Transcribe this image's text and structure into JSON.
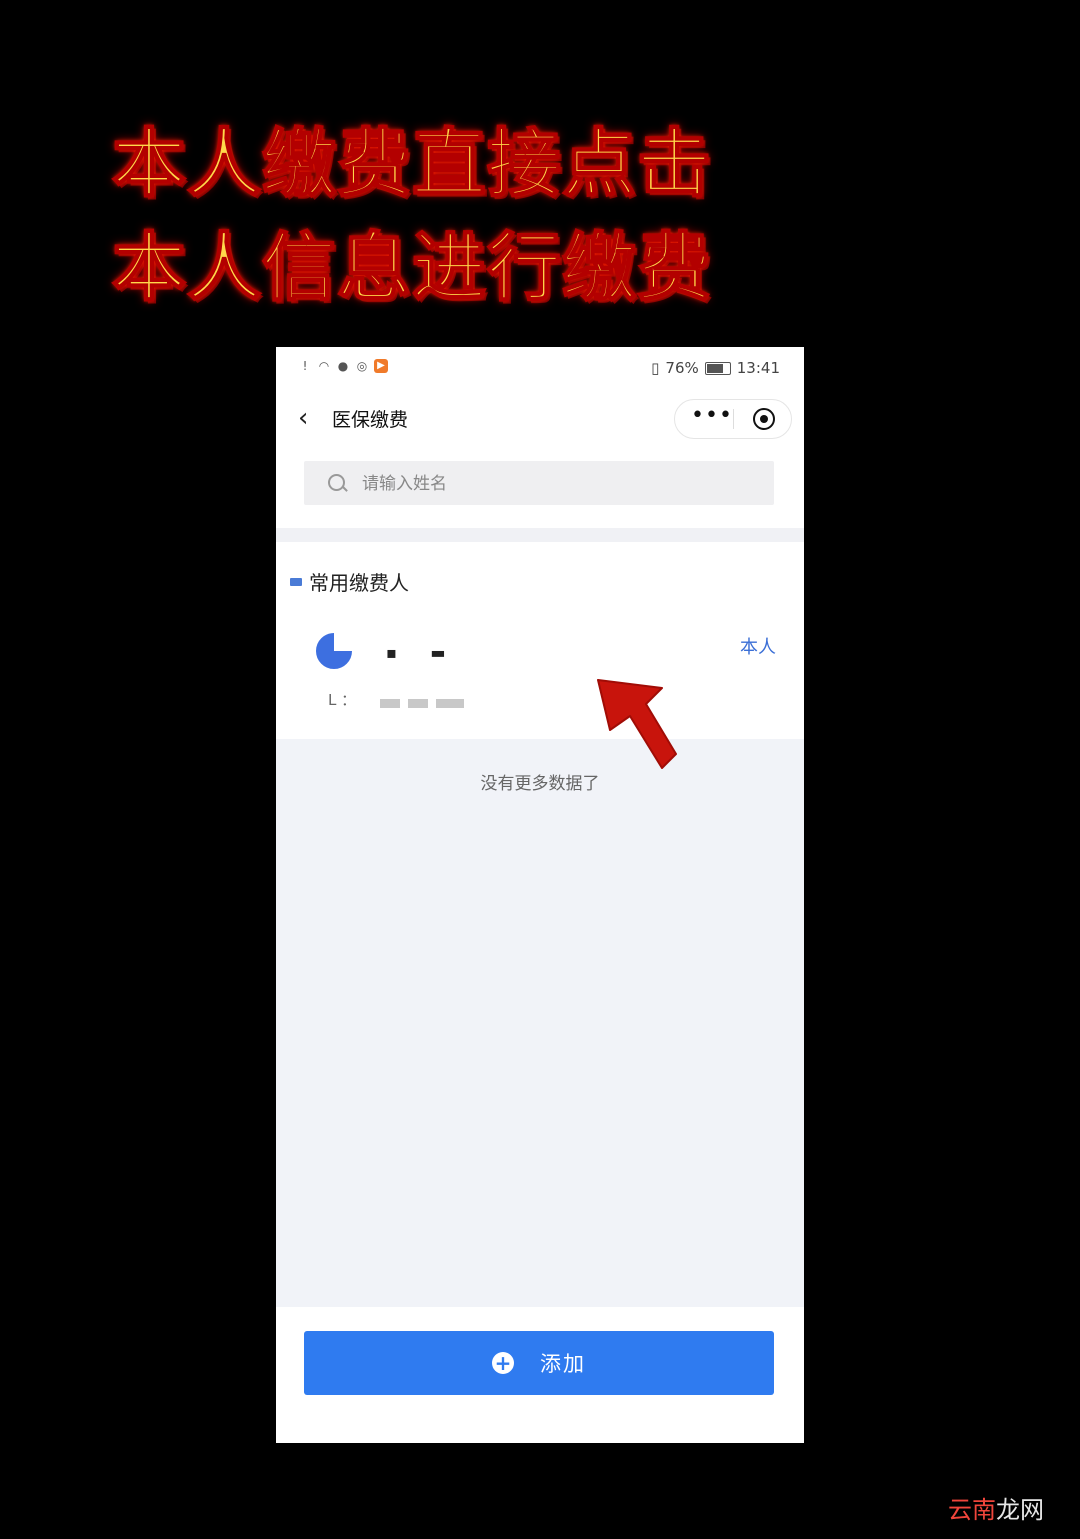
{
  "caption": {
    "line1": "本人缴费直接点击",
    "line2": "本人信息进行缴费"
  },
  "status_bar": {
    "battery": "76%",
    "time": "13:41"
  },
  "nav": {
    "title": "医保缴费",
    "more_icon": "more-dots-icon",
    "close_icon": "target-icon"
  },
  "search": {
    "placeholder": "请输入姓名"
  },
  "section": {
    "title": "常用缴费人"
  },
  "payer": {
    "name_mask": "▪ ▬",
    "tag": "本人",
    "id_label": "L ："
  },
  "empty": {
    "text": "没有更多数据了"
  },
  "footer": {
    "add_label": "添加"
  },
  "watermark": {
    "brand_red": "云南",
    "brand_white": "龙网"
  },
  "colors": {
    "accent": "#2f7bf0",
    "tag_blue": "#3b6fd6",
    "caption_yellow": "#ffd84a",
    "annotation_red": "#c8140c"
  }
}
